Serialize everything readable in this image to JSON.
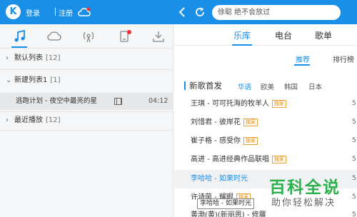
{
  "header": {
    "logo_letter": "K",
    "login_label": "登录",
    "register_label": "注册",
    "search_placeholder": "徐聪 绝不会放过"
  },
  "left_panel": {
    "tabs": [
      "music-note",
      "cloud",
      "radio",
      "device",
      "download"
    ],
    "groups": [
      {
        "name": "默认列表",
        "count": "[12]"
      },
      {
        "name": "新建列表1",
        "count": "[1]"
      },
      {
        "name": "最近播放",
        "count": "[12]"
      }
    ],
    "current_song": {
      "title": "逃跑计划 - 夜空中最亮的星",
      "duration": "04:12"
    }
  },
  "right_panel": {
    "main_tabs": [
      "乐库",
      "电台",
      "歌单"
    ],
    "sub_tabs": [
      "推荐",
      "排行榜"
    ],
    "section_title": "新歌首发",
    "regions": [
      "华语",
      "欧美",
      "韩国",
      "日本"
    ],
    "songs": [
      {
        "text": "王琪 - 可可托海的牧羊人",
        "badge": "独家"
      },
      {
        "text": "刘惜君 - 彼岸花",
        "badge": "独家"
      },
      {
        "text": "崔子格 - 感受你",
        "badge": "独家"
      },
      {
        "text": "高进 - 高进经典作品联唱",
        "badge": "独家"
      },
      {
        "text": "李哈哈 - 如果时光",
        "badge": ""
      },
      {
        "text": "许诗茵 - 耀眼",
        "badge": "独家"
      },
      {
        "text": "黄渤(黄)(新丽恩) - 修羅",
        "badge": ""
      }
    ],
    "row_trailing": [
      "5",
      "5",
      "5",
      "5",
      "5",
      "5",
      "5"
    ]
  },
  "tooltip": "李哈哈 - 如果时光",
  "watermark": {
    "main": "百科全说",
    "sub": "助你轻松解决"
  },
  "colors": {
    "accent": "#1a8fe8",
    "badge": "#e08900",
    "watermark": "#2cb24d"
  }
}
